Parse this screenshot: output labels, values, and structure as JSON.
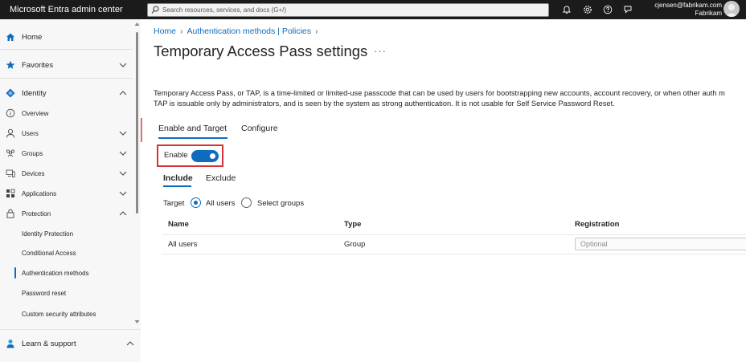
{
  "topbar": {
    "app_title": "Microsoft Entra admin center",
    "search_placeholder": "Search resources, services, and docs (G+/)",
    "account_email": "cjensen@fabrikam.com",
    "account_tenant": "Fabrikam"
  },
  "sidebar": {
    "home": "Home",
    "favorites": "Favorites",
    "identity": "Identity",
    "overview": "Overview",
    "users": "Users",
    "groups": "Groups",
    "devices": "Devices",
    "applications": "Applications",
    "protection": "Protection",
    "identity_protection": "Identity Protection",
    "conditional_access": "Conditional Access",
    "authentication_methods": "Authentication methods",
    "password_reset": "Password reset",
    "custom_security_attributes": "Custom security attributes",
    "learn_support": "Learn & support"
  },
  "breadcrumb": {
    "home": "Home",
    "policies": "Authentication methods | Policies"
  },
  "page": {
    "title": "Temporary Access Pass settings",
    "more": "···",
    "description_line1": "Temporary Access Pass, or TAP, is a time-limited or limited-use passcode that can be used by users for bootstrapping new accounts, account recovery, or when other auth m",
    "description_line2": "TAP is issuable only by administrators, and is seen by the system as strong authentication. It is not usable for Self Service Password Reset."
  },
  "tabs": {
    "enable_target": "Enable and Target",
    "configure": "Configure"
  },
  "enable": {
    "label": "Enable",
    "state": "on"
  },
  "subtabs": {
    "include": "Include",
    "exclude": "Exclude"
  },
  "target": {
    "label": "Target",
    "all_users": "All users",
    "select_groups": "Select groups",
    "selected": "All users"
  },
  "table": {
    "headers": {
      "name": "Name",
      "type": "Type",
      "registration": "Registration"
    },
    "rows": [
      {
        "name": "All users",
        "type": "Group",
        "registration": "Optional"
      }
    ]
  },
  "colors": {
    "accent": "#0f6cbd",
    "highlight_border": "#d13438",
    "topbar": "#1b1b1b"
  }
}
